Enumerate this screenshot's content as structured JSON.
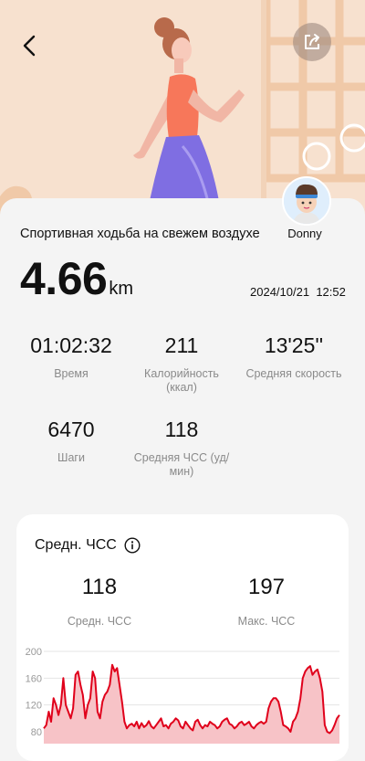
{
  "header": {
    "back_icon": "chevron-left-icon",
    "share_icon": "share-icon"
  },
  "user": {
    "name": "Donny"
  },
  "activity": {
    "title": "Спортивная ходьба на свежем воздухе",
    "distance_value": "4.66",
    "distance_unit": "km",
    "date": "2024/10/21",
    "time": "12:52"
  },
  "stats": [
    {
      "value": "01:02:32",
      "label": "Время"
    },
    {
      "value": "211",
      "label": "Калорийность\n(ккал)"
    },
    {
      "value": "13'25''",
      "label": "Средняя скорость"
    },
    {
      "value": "6470",
      "label": "Шаги"
    },
    {
      "value": "118",
      "label": "Средняя ЧСС (уд/\nмин)"
    }
  ],
  "heart_rate": {
    "title": "Средн. ЧСС",
    "avg_value": "118",
    "avg_label": "Средн. ЧСС",
    "max_value": "197",
    "max_label": "Макс. ЧСС"
  },
  "chart_data": {
    "type": "area",
    "yticks": [
      200,
      160,
      120,
      80
    ],
    "ylim": [
      80,
      200
    ],
    "color": "#e0001b",
    "fill": "#f7c3c7",
    "values": [
      85,
      90,
      110,
      95,
      130,
      120,
      105,
      120,
      160,
      120,
      110,
      100,
      115,
      165,
      170,
      150,
      135,
      100,
      120,
      130,
      170,
      160,
      110,
      100,
      125,
      135,
      140,
      150,
      180,
      170,
      175,
      150,
      125,
      95,
      85,
      90,
      92,
      88,
      95,
      85,
      93,
      87,
      90,
      96,
      88,
      85,
      90,
      95,
      100,
      88,
      90,
      85,
      92,
      95,
      100,
      97,
      88,
      85,
      95,
      90,
      85,
      82,
      95,
      98,
      90,
      85,
      90,
      88,
      95,
      92,
      90,
      85,
      88,
      95,
      98,
      100,
      92,
      90,
      85,
      88,
      93,
      95,
      90,
      92,
      95,
      88,
      85,
      90,
      93,
      95,
      92,
      95,
      115,
      125,
      130,
      130,
      125,
      110,
      90,
      88,
      85,
      80,
      95,
      100,
      110,
      130,
      160,
      170,
      175,
      178,
      165,
      170,
      173,
      160,
      140,
      90,
      80,
      78,
      82,
      90,
      100,
      105
    ]
  },
  "colors": {
    "hero_background": "#f7e1cf",
    "accent_red": "#e0001b",
    "label_gray": "#8a8a8a"
  }
}
